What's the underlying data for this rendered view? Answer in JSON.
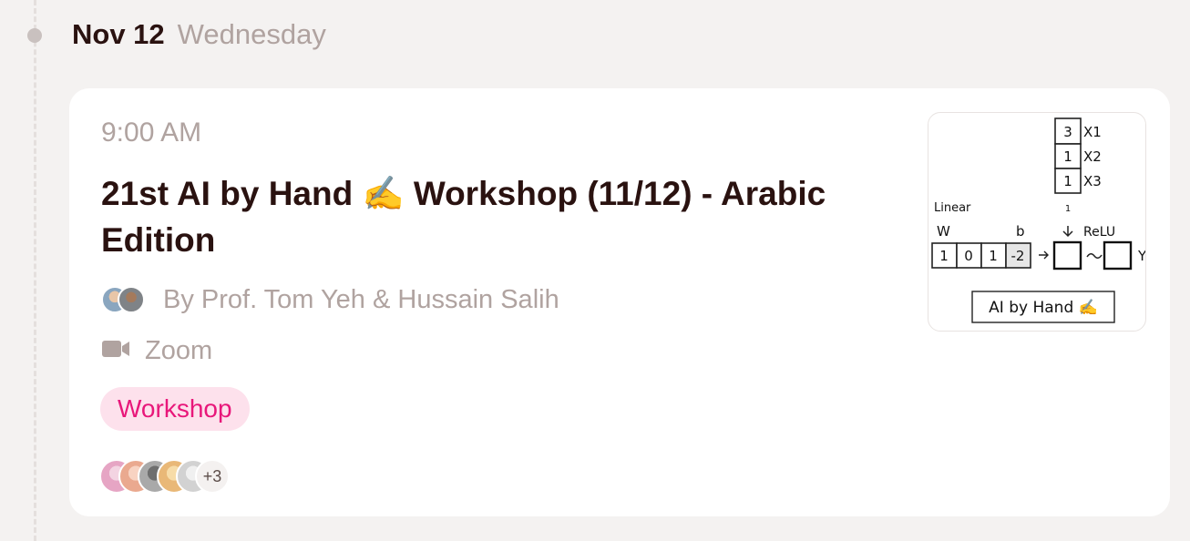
{
  "date": {
    "day": "Nov 12",
    "weekday": "Wednesday"
  },
  "event": {
    "time": "9:00 AM",
    "title": "21st AI by Hand ✍️ Workshop (11/12) - Arabic Edition",
    "hosts": "By Prof. Tom Yeh & Hussain Salih",
    "location": "Zoom",
    "tag": "Workshop",
    "guests_more": "+3",
    "cover": {
      "x_labels": [
        "X1",
        "X2",
        "X3"
      ],
      "x_values": [
        "3",
        "1",
        "1"
      ],
      "linear_label": "Linear",
      "one_label": "1",
      "w_label": "W",
      "b_label": "b",
      "relu_label": "ReLU",
      "w_values": [
        "1",
        "0",
        "1"
      ],
      "b_value": "-2",
      "y_label": "Y",
      "brand": "AI by Hand ✍️"
    }
  },
  "icon_names": [
    "video-camera-icon"
  ],
  "colors": {
    "tag_bg": "#fde1ec",
    "tag_text": "#e8177a",
    "title": "#2a1210",
    "muted": "#b0a3a0"
  }
}
